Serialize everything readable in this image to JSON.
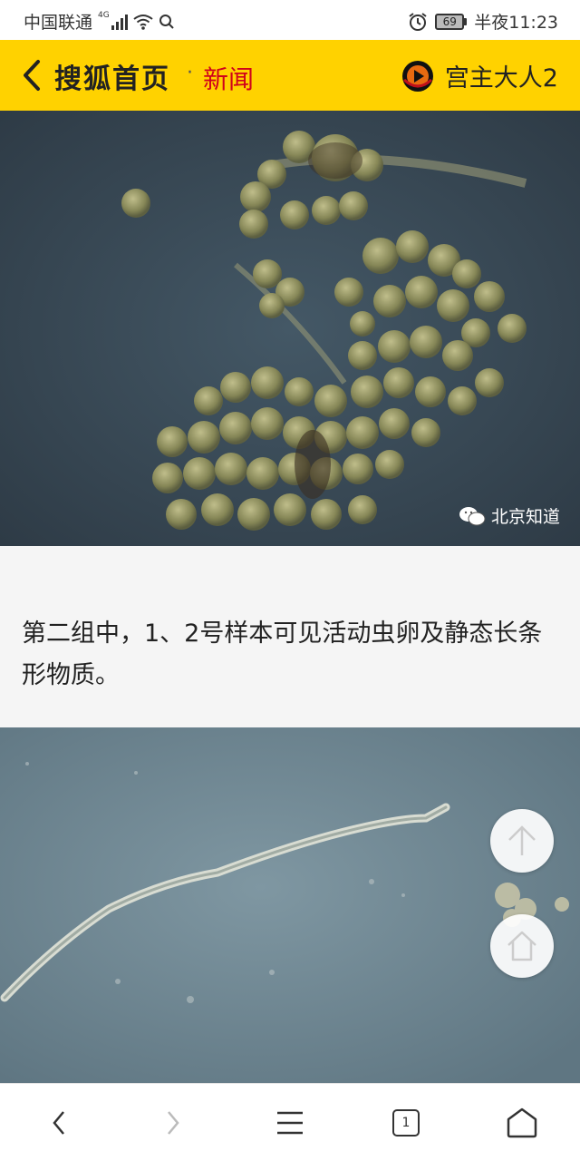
{
  "status_bar": {
    "carrier": "中国联通",
    "network": "4G",
    "battery": "69",
    "time": "半夜11:23"
  },
  "header": {
    "logo": "搜狐首页",
    "separator": "·",
    "channel": "新闻",
    "username": "宫主大人2"
  },
  "article": {
    "image1_watermark": "北京知道",
    "caption": "第二组中，1、2号样本可见活动虫卵及静态长条形物质。"
  },
  "bottom_nav": {
    "tab_count": "1"
  },
  "colors": {
    "header_bg": "#ffd200",
    "channel_red": "#d0021b"
  }
}
